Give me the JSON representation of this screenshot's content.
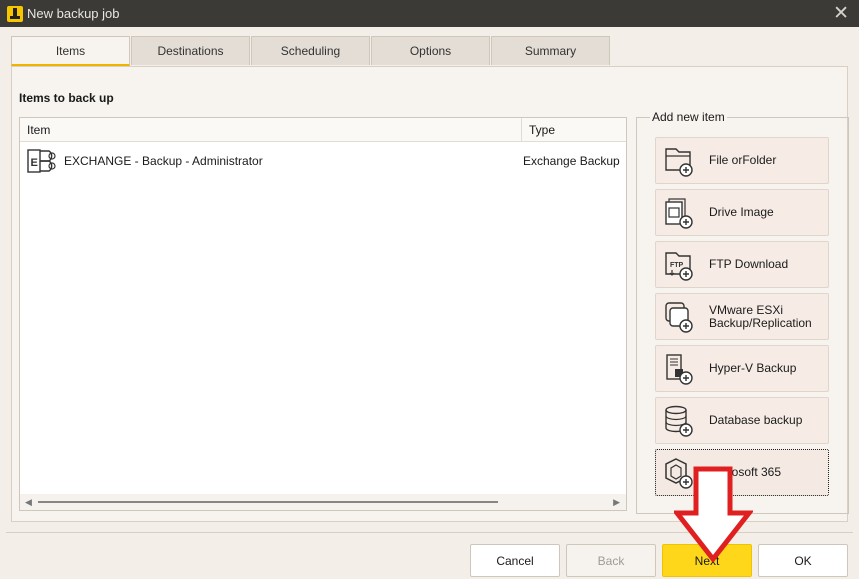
{
  "window": {
    "title": "New backup job",
    "close_glyph": "✕"
  },
  "tabs": [
    {
      "label": "Items",
      "active": true
    },
    {
      "label": "Destinations",
      "active": false
    },
    {
      "label": "Scheduling",
      "active": false
    },
    {
      "label": "Options",
      "active": false
    },
    {
      "label": "Summary",
      "active": false
    }
  ],
  "items_section": {
    "title": "Items to back up",
    "columns": {
      "item": "Item",
      "type": "Type"
    },
    "rows": [
      {
        "item": "EXCHANGE - Backup - Administrator",
        "type": "Exchange Backup",
        "icon": "exchange-icon"
      }
    ]
  },
  "add_new_item": {
    "legend": "Add new item",
    "buttons": [
      {
        "label": "File orFolder",
        "icon": "file-folder-icon"
      },
      {
        "label": "Drive Image",
        "icon": "drive-image-icon"
      },
      {
        "label": "FTP Download",
        "icon": "ftp-download-icon"
      },
      {
        "label": "VMware ESXi Backup/Replication",
        "icon": "vmware-icon"
      },
      {
        "label": "Hyper-V Backup",
        "icon": "hyperv-icon"
      },
      {
        "label": "Database backup",
        "icon": "database-icon"
      },
      {
        "label": "Microsoft 365",
        "icon": "microsoft365-icon"
      }
    ]
  },
  "footer": {
    "cancel": "Cancel",
    "back": "Back",
    "next": "Next",
    "ok": "OK"
  },
  "colors": {
    "accent": "#ffd71a",
    "tab_underline": "#f0b400",
    "annotation_arrow": "#e02020"
  }
}
